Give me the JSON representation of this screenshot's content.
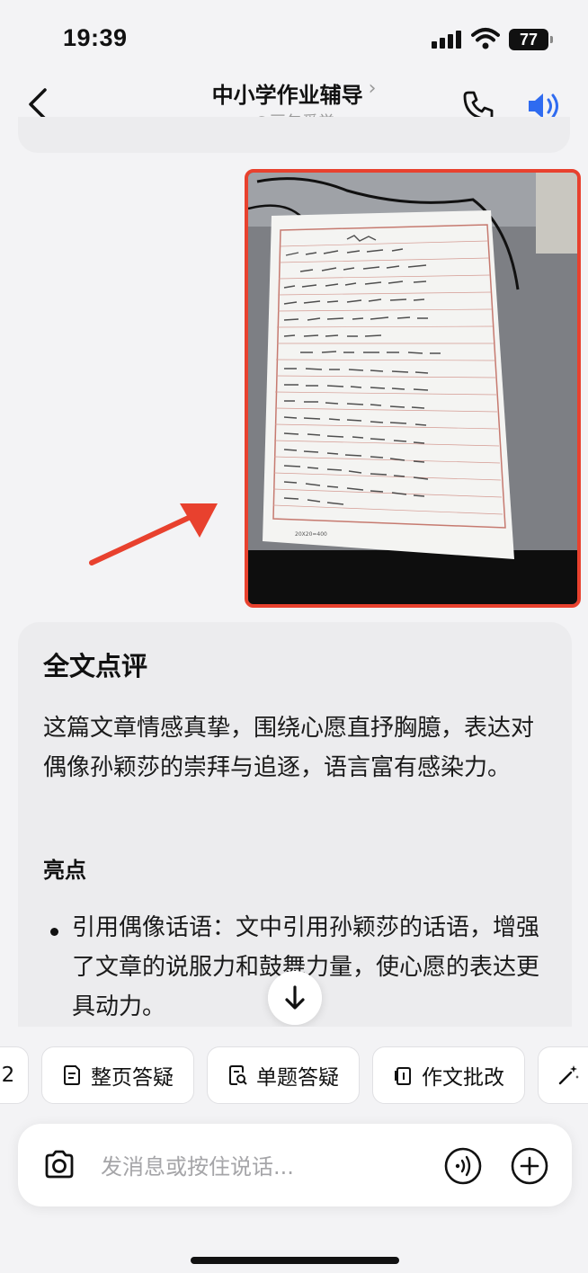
{
  "status_bar": {
    "time": "19:39",
    "battery": "77"
  },
  "header": {
    "title": "中小学作业辅导",
    "subtitle": "@豆包爱学"
  },
  "review": {
    "heading": "全文点评",
    "summary": "这篇文章情感真挚，围绕心愿直抒胸臆，表达对偶像孙颖莎的崇拜与追逐，语言富有感染力。",
    "highlights_heading": "亮点",
    "highlights": [
      "引用偶像话语：文中引用孙颖莎的话语，增强了文章的说服力和鼓舞力量，使心愿的表达更具动力。"
    ]
  },
  "chips": {
    "partial_left": "2",
    "items": [
      {
        "label": "整页答疑",
        "icon": "page-doc-icon"
      },
      {
        "label": "单题答疑",
        "icon": "question-search-icon"
      },
      {
        "label": "作文批改",
        "icon": "essay-icon"
      }
    ],
    "partial_right_icon": "magic-wand-icon"
  },
  "input": {
    "placeholder": "发消息或按住说话..."
  },
  "colors": {
    "accent_blue": "#2f6bf0",
    "highlight_red": "#e8412e"
  }
}
